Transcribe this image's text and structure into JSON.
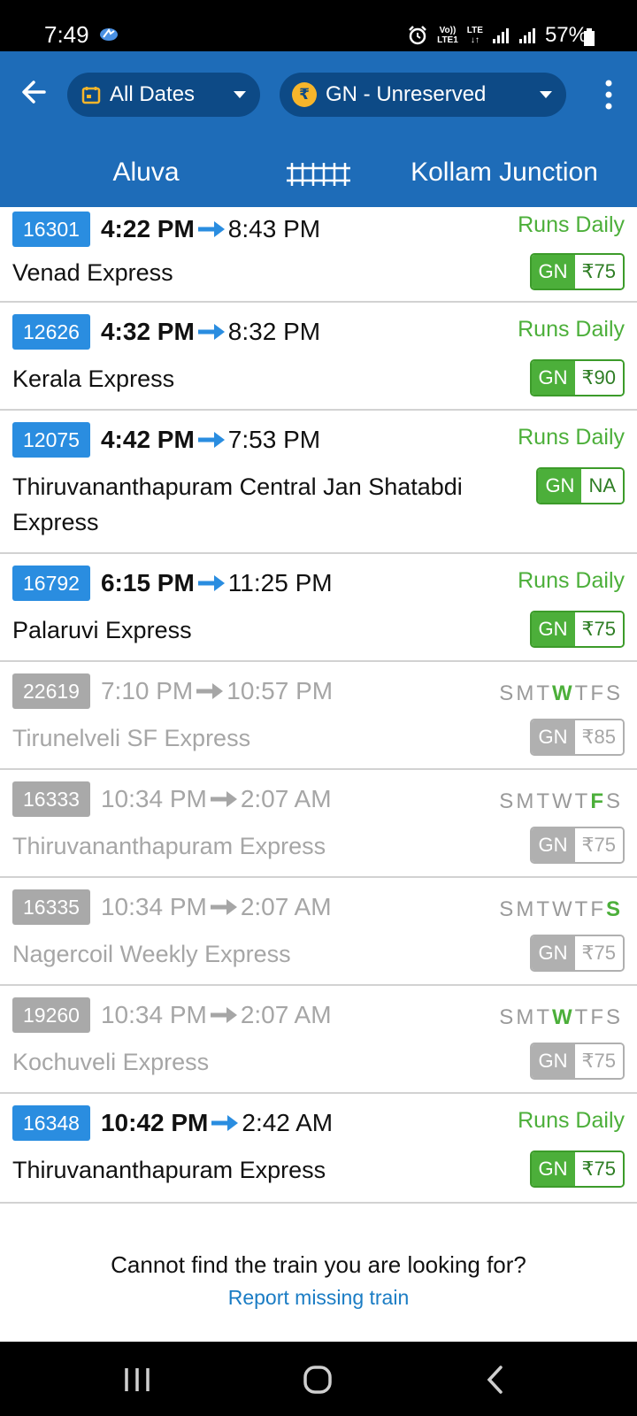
{
  "status_bar": {
    "time": "7:49",
    "signal_label_top": "Vo))",
    "signal_label_bottom": "LTE1",
    "lte": "LTE",
    "battery": "57%"
  },
  "app_bar": {
    "dates_label": "All Dates",
    "class_label": "GN - Unreserved",
    "rupee_symbol": "₹"
  },
  "route": {
    "from": "Aluva",
    "to": "Kollam Junction"
  },
  "trains": [
    {
      "number": "16301",
      "dep": "4:22 PM",
      "arr": "8:43 PM",
      "runs": "Runs Daily",
      "days": null,
      "name": "Venad Express",
      "fare_class": "GN",
      "fare": "₹75",
      "active": true
    },
    {
      "number": "12626",
      "dep": "4:32 PM",
      "arr": "8:32 PM",
      "runs": "Runs Daily",
      "days": null,
      "name": "Kerala Express",
      "fare_class": "GN",
      "fare": "₹90",
      "active": true
    },
    {
      "number": "12075",
      "dep": "4:42 PM",
      "arr": "7:53 PM",
      "runs": "Runs Daily",
      "days": null,
      "name_line1": "Thiruvananthapuram Central Jan Shatabdi",
      "name_line2": "Express",
      "fare_class": "GN",
      "fare": "NA",
      "active": true
    },
    {
      "number": "16792",
      "dep": "6:15 PM",
      "arr": "11:25 PM",
      "runs": "Runs Daily",
      "days": null,
      "name": "Palaruvi Express",
      "fare_class": "GN",
      "fare": "₹75",
      "active": true
    },
    {
      "number": "22619",
      "dep": "7:10 PM",
      "arr": "10:57 PM",
      "runs": null,
      "days": [
        "S",
        "M",
        "T",
        "W",
        "T",
        "F",
        "S"
      ],
      "on_day": 3,
      "name": "Tirunelveli SF Express",
      "fare_class": "GN",
      "fare": "₹85",
      "active": false
    },
    {
      "number": "16333",
      "dep": "10:34 PM",
      "arr": "2:07 AM",
      "runs": null,
      "days": [
        "S",
        "M",
        "T",
        "W",
        "T",
        "F",
        "S"
      ],
      "on_day": 5,
      "name": "Thiruvananthapuram Express",
      "fare_class": "GN",
      "fare": "₹75",
      "active": false
    },
    {
      "number": "16335",
      "dep": "10:34 PM",
      "arr": "2:07 AM",
      "runs": null,
      "days": [
        "S",
        "M",
        "T",
        "W",
        "T",
        "F",
        "S"
      ],
      "on_day": 6,
      "name": "Nagercoil Weekly Express",
      "fare_class": "GN",
      "fare": "₹75",
      "active": false
    },
    {
      "number": "19260",
      "dep": "10:34 PM",
      "arr": "2:07 AM",
      "runs": null,
      "days": [
        "S",
        "M",
        "T",
        "W",
        "T",
        "F",
        "S"
      ],
      "on_day": 3,
      "name": "Kochuveli Express",
      "fare_class": "GN",
      "fare": "₹75",
      "active": false
    },
    {
      "number": "16348",
      "dep": "10:42 PM",
      "arr": "2:42 AM",
      "runs": "Runs Daily",
      "days": null,
      "name": "Thiruvananthapuram Express",
      "fare_class": "GN",
      "fare": "₹75",
      "active": true
    }
  ],
  "footer": {
    "question": "Cannot find the train you are looking for?",
    "link": "Report missing train"
  },
  "colors": {
    "header_blue": "#1e6cb8",
    "pill_blue": "#0d4a86",
    "train_no_blue": "#2a8de0",
    "runs_green": "#4caf3a",
    "link_blue": "#1a7cc4"
  }
}
